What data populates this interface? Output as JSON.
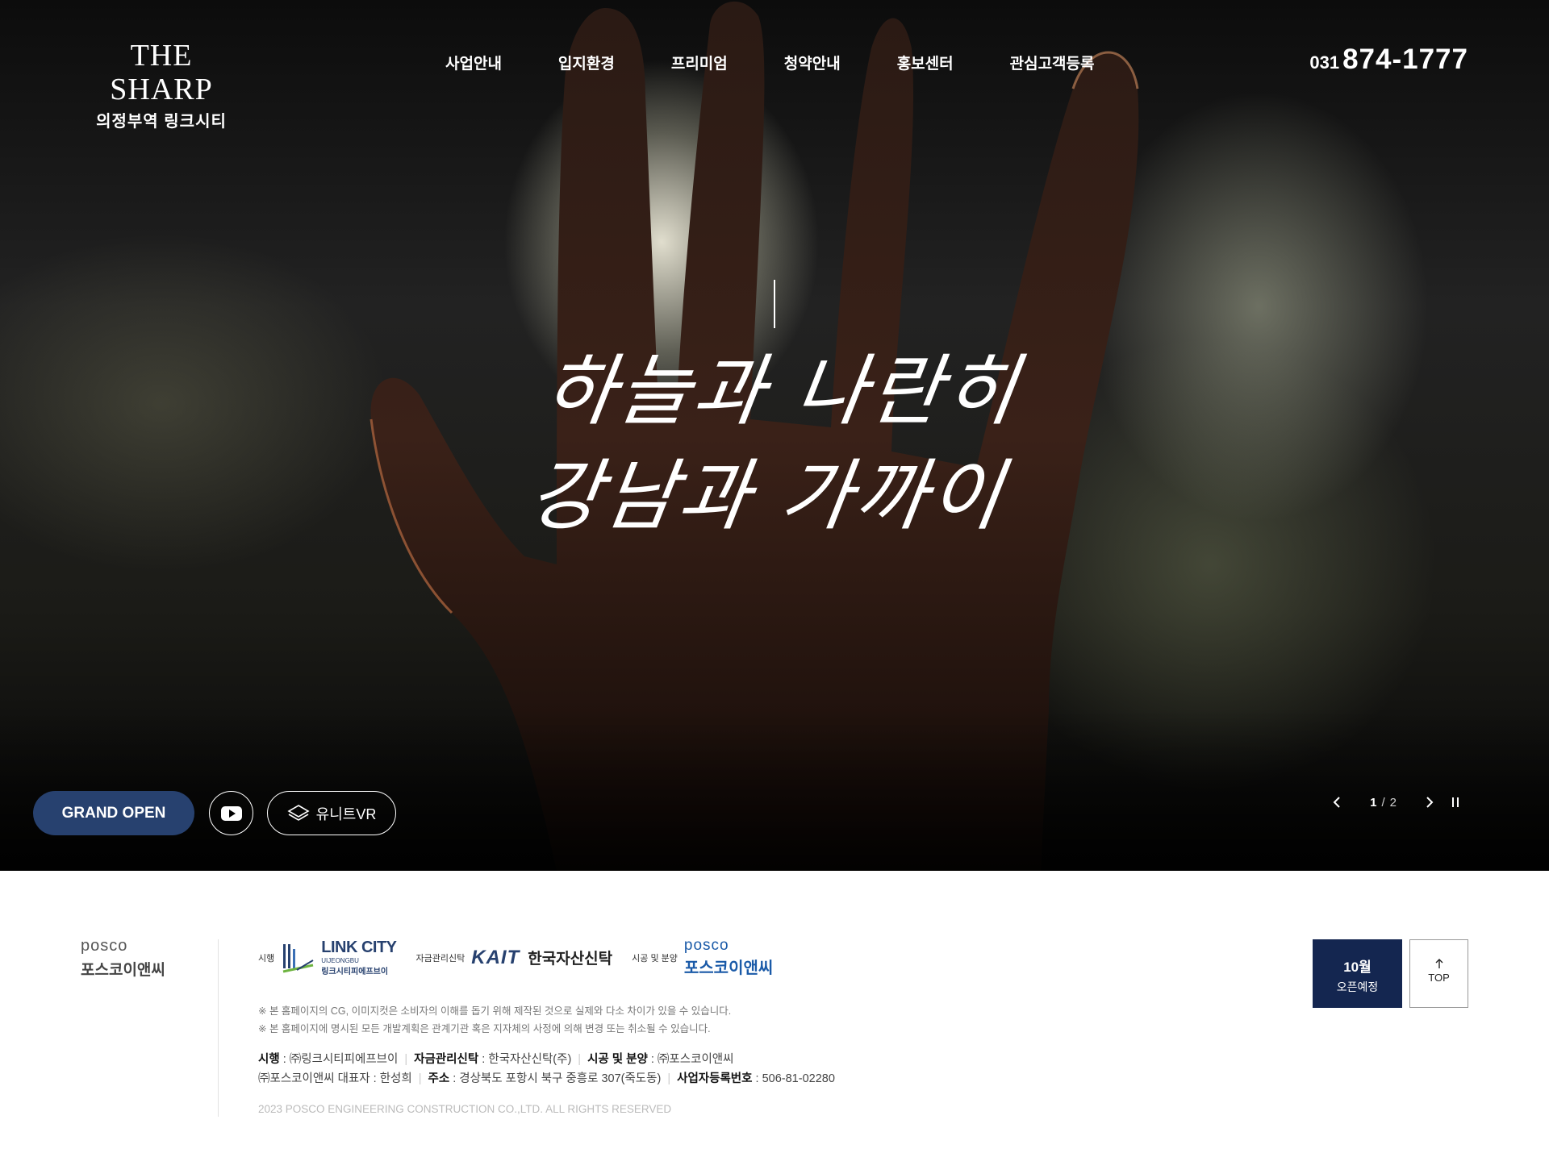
{
  "logo": {
    "brand": "THE SHARP",
    "sub": "의정부역 링크시티"
  },
  "nav": {
    "items": [
      "사업안내",
      "입지환경",
      "프리미엄",
      "청약안내",
      "홍보센터",
      "관심고객등록"
    ]
  },
  "phone": {
    "area": "031",
    "number": "874-1777"
  },
  "hero": {
    "line1": "하늘과 나란히",
    "line2": "강남과 가까이"
  },
  "actions": {
    "grand_open": "GRAND OPEN",
    "vr_label": "유니트VR"
  },
  "slider": {
    "current": "1",
    "separator": "/",
    "total": "2"
  },
  "footer": {
    "posco_en": "posco",
    "posco_ko": "포스코이앤씨",
    "partners": {
      "developer_role": "시행",
      "developer_name": "LINK CITY",
      "developer_sub": "UIJEONGBU",
      "developer_ko": "링크시티피에프브이",
      "trust_role": "자금관리신탁",
      "trust_logo": "KAIT",
      "trust_name": "한국자산신탁",
      "builder_role": "시공 및 분양",
      "builder_en": "posco",
      "builder_ko": "포스코이앤씨"
    },
    "notes": [
      "※ 본 홈페이지의 CG, 이미지컷은 소비자의 이해를 돕기 위해 제작된 것으로 실제와 다소 차이가 있을 수 있습니다.",
      "※ 본 홈페이지에 명시된 모든 개발계획은 관계기관 혹은 지자체의 사정에 의해 변경 또는 취소될 수 있습니다."
    ],
    "info": {
      "l1_k1": "시행",
      "l1_v1": " : ㈜링크시티피에프브이",
      "l1_k2": "자금관리신탁",
      "l1_v2": " : 한국자산신탁(주)",
      "l1_k3": "시공 및 분양",
      "l1_v3": "  : ㈜포스코이앤씨",
      "l2_v0": "㈜포스코이앤씨 대표자 : 한성희",
      "l2_k1": "주소",
      "l2_v1": " : 경상북도 포항시 북구 중흥로 307(죽도동)",
      "l2_k2": "사업자등록번호",
      "l2_v2": " : 506-81-02280"
    },
    "copyright": "2023 POSCO ENGINEERING CONSTRUCTION CO.,LTD. ALL RIGHTS RESERVED",
    "open_badge": {
      "month": "10월",
      "text": "오픈예정"
    },
    "top_label": "TOP"
  },
  "colors": {
    "navy": "#27416f",
    "badge": "#142650",
    "posco_blue": "#1a5aa8"
  },
  "icons": [
    "youtube-icon",
    "vr-cube-icon",
    "chevron-left-icon",
    "chevron-right-icon",
    "pause-icon",
    "arrow-up-icon"
  ]
}
